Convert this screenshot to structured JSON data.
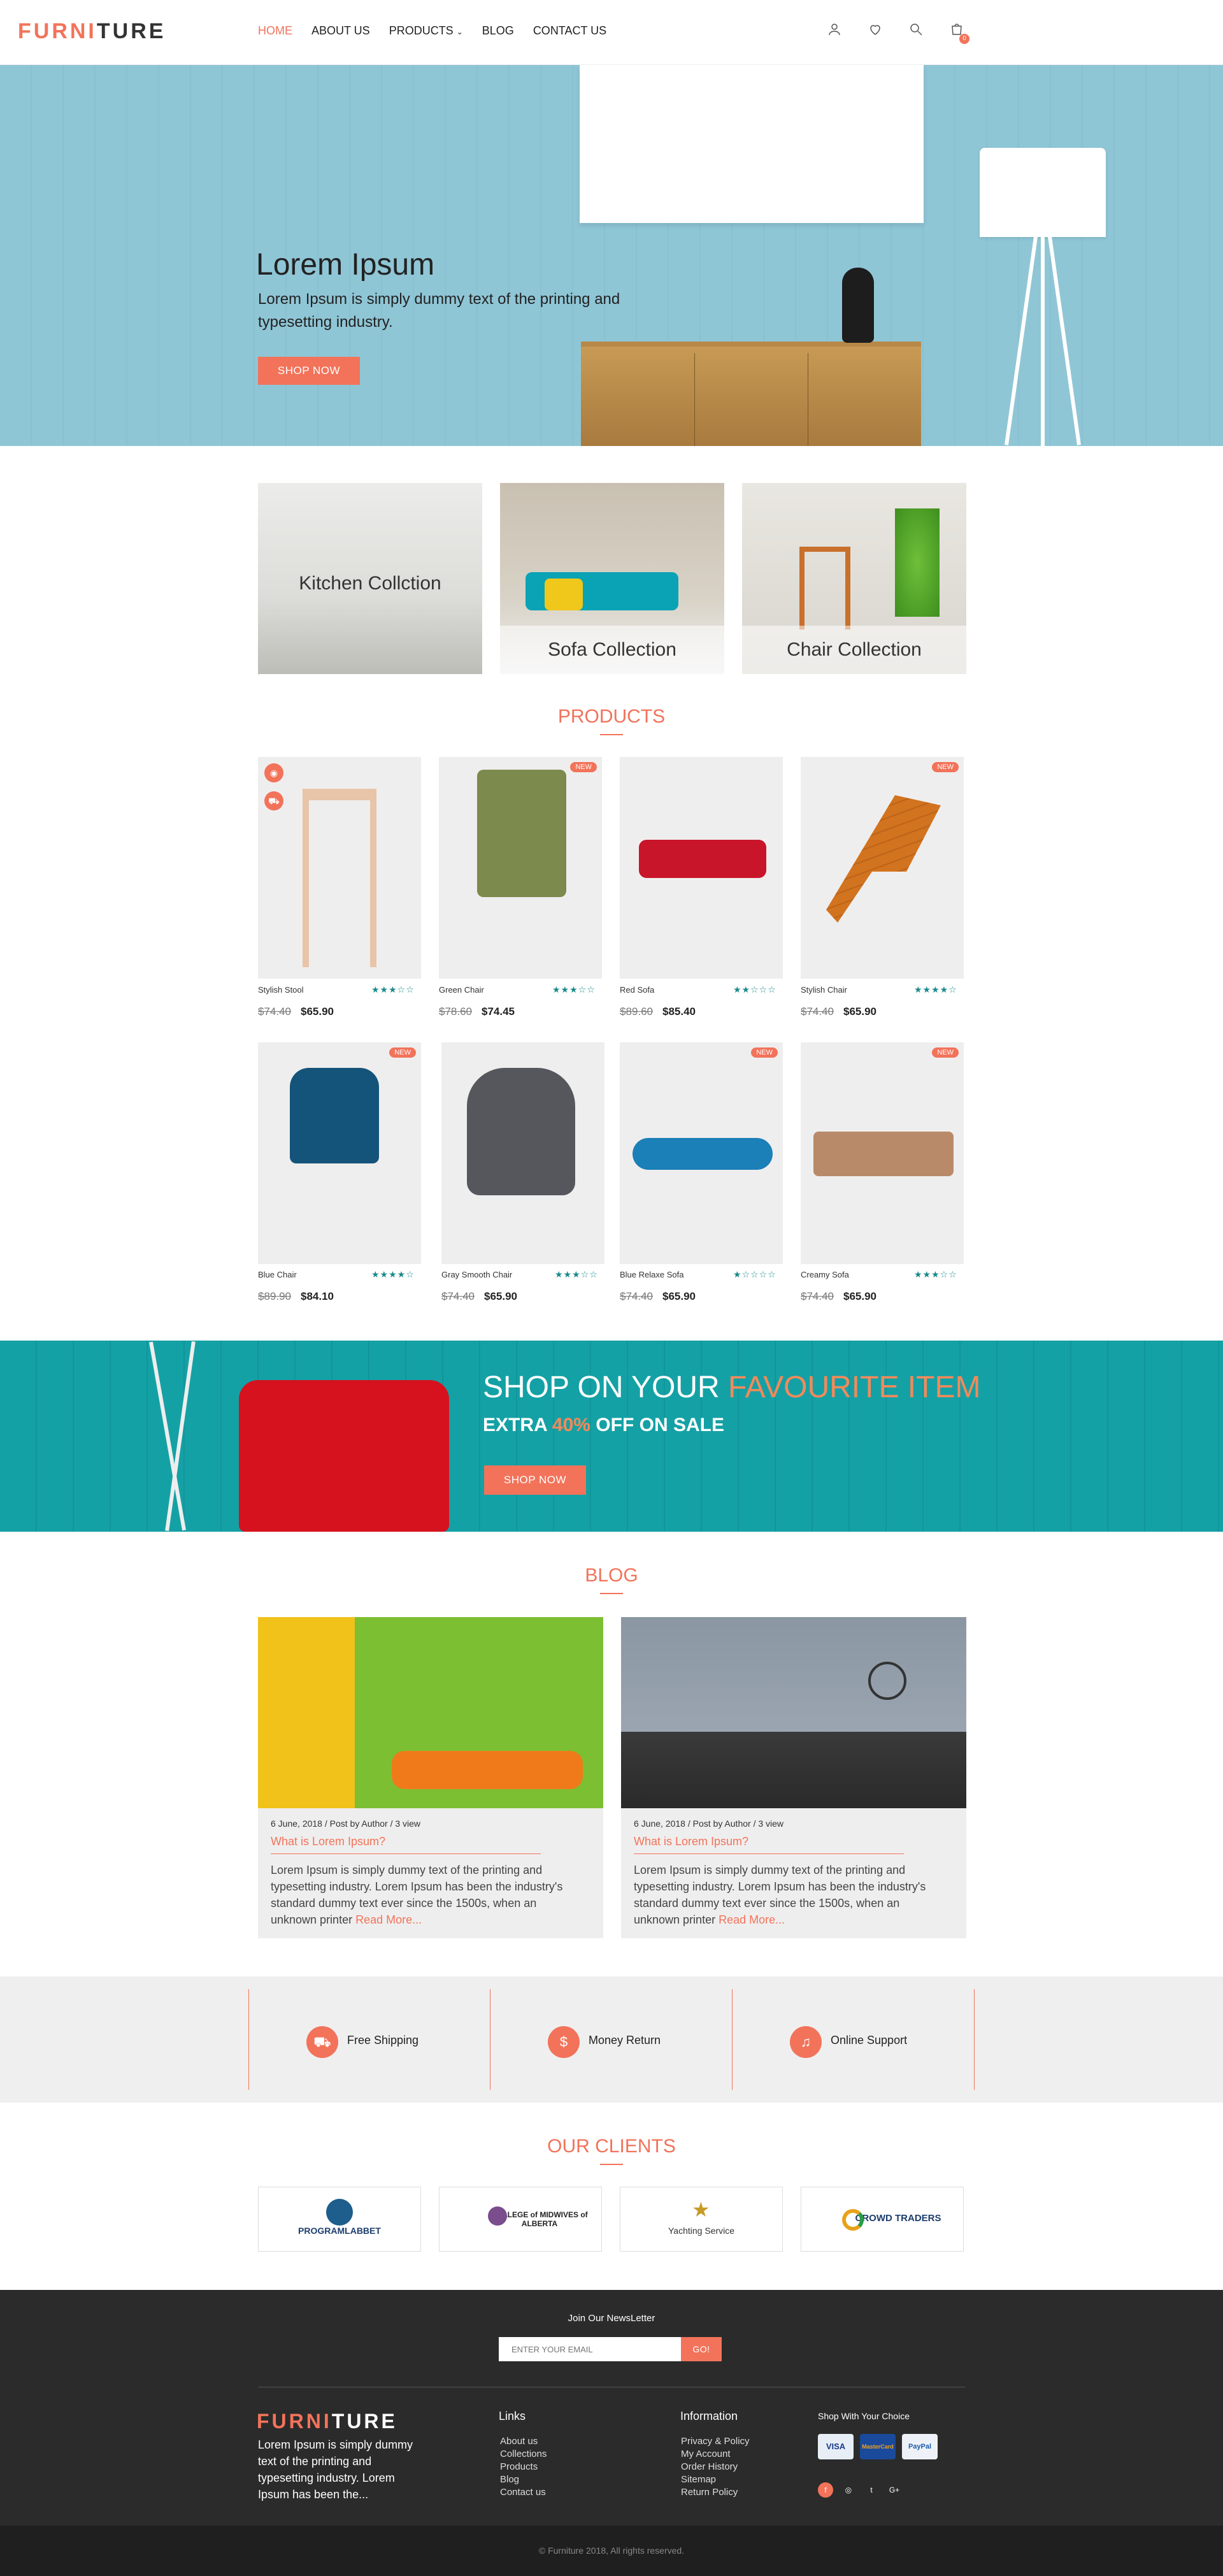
{
  "header": {
    "logo_a": "FURNI",
    "logo_b": "TURE",
    "nav": [
      "HOME",
      "ABOUT US",
      "PRODUCTS",
      "BLOG",
      "CONTACT US"
    ],
    "cart_count": "0"
  },
  "hero": {
    "title": "Lorem Ipsum",
    "text": "Lorem Ipsum is simply dummy text of the printing and typesetting industry.",
    "button": "SHOP NOW"
  },
  "collections": [
    "Kitchen Collction",
    "Sofa Collection",
    "Chair Collection"
  ],
  "products_title": "PRODUCTS",
  "products": [
    {
      "name": "Stylish Stool",
      "old": "$74.40",
      "price": "$65.90",
      "stars": "★★★☆☆",
      "new": false
    },
    {
      "name": "Green Chair",
      "old": "$78.60",
      "price": "$74.45",
      "stars": "★★★☆☆",
      "new": true
    },
    {
      "name": "Red Sofa",
      "old": "$89.60",
      "price": "$85.40",
      "stars": "★★☆☆☆",
      "new": false
    },
    {
      "name": "Stylish Chair",
      "old": "$74.40",
      "price": "$65.90",
      "stars": "★★★★☆",
      "new": true
    },
    {
      "name": "Blue Chair",
      "old": "$89.90",
      "price": "$84.10",
      "stars": "★★★★☆",
      "new": true
    },
    {
      "name": "Gray Smooth Chair",
      "old": "$74.40",
      "price": "$65.90",
      "stars": "★★★☆☆",
      "new": false
    },
    {
      "name": "Blue Relaxe Sofa",
      "old": "$74.40",
      "price": "$65.90",
      "stars": "★☆☆☆☆",
      "new": true
    },
    {
      "name": "Creamy Sofa",
      "old": "$74.40",
      "price": "$65.90",
      "stars": "★★★☆☆",
      "new": true
    }
  ],
  "new_label": "NEW",
  "promo": {
    "title_a": "SHOP ON YOUR ",
    "title_b": "FAVOURITE ITEM",
    "sub_a": "EXTRA ",
    "sub_b": "40%",
    "sub_c": " OFF ON SALE",
    "button": "SHOP NOW"
  },
  "blog_title": "BLOG",
  "blog": [
    {
      "meta": "6 June, 2018  /  Post by Author  /  3 view",
      "title": "What is Lorem Ipsum?",
      "text": "Lorem Ipsum is simply dummy text of the printing and typesetting industry. Lorem Ipsum has been the industry's standard dummy text ever since the 1500s, when an unknown printer ",
      "more": "Read More..."
    },
    {
      "meta": "6 June, 2018  /  Post by Author  /  3 view",
      "title": "What is Lorem Ipsum?",
      "text": "Lorem Ipsum is simply dummy text of the printing and typesetting industry. Lorem Ipsum has been the industry's standard dummy text ever since the 1500s, when an unknown printer ",
      "more": "Read More..."
    }
  ],
  "features": [
    "Free Shipping",
    "Money Return",
    "Online Support"
  ],
  "clients_title": "OUR CLIENTS",
  "clients": [
    {
      "name": "PROGRAMLABBET",
      "color": "#1d5e8c"
    },
    {
      "name": "COLLEGE of MIDWIVES of ALBERTA",
      "color": "#222222"
    },
    {
      "name": "Yachting Service",
      "color": "#333333"
    },
    {
      "name": "CROWD TRADERS",
      "color": "#1d3d6e"
    }
  ],
  "footer": {
    "newsletter": "Join Our NewsLetter",
    "email_placeholder": "ENTER YOUR EMAIL",
    "go": "GO!",
    "logo_a": "FURNI",
    "logo_b": "TURE",
    "about": "Lorem Ipsum is simply dummy text of the printing and typesetting industry. Lorem Ipsum has been the...",
    "links_title": "Links",
    "links": [
      "About us",
      "Collections",
      "Products",
      "Blog",
      "Contact us"
    ],
    "info_title": "Information",
    "info": [
      "Privacy & Policy",
      "My Account",
      "Order History",
      "Sitemap",
      "Return Policy"
    ],
    "shop_title": "Shop With Your Choice",
    "payments": [
      "VISA",
      "MasterCard",
      "PayPal"
    ],
    "copyright": "© Furniture 2018, All rights reserved."
  }
}
